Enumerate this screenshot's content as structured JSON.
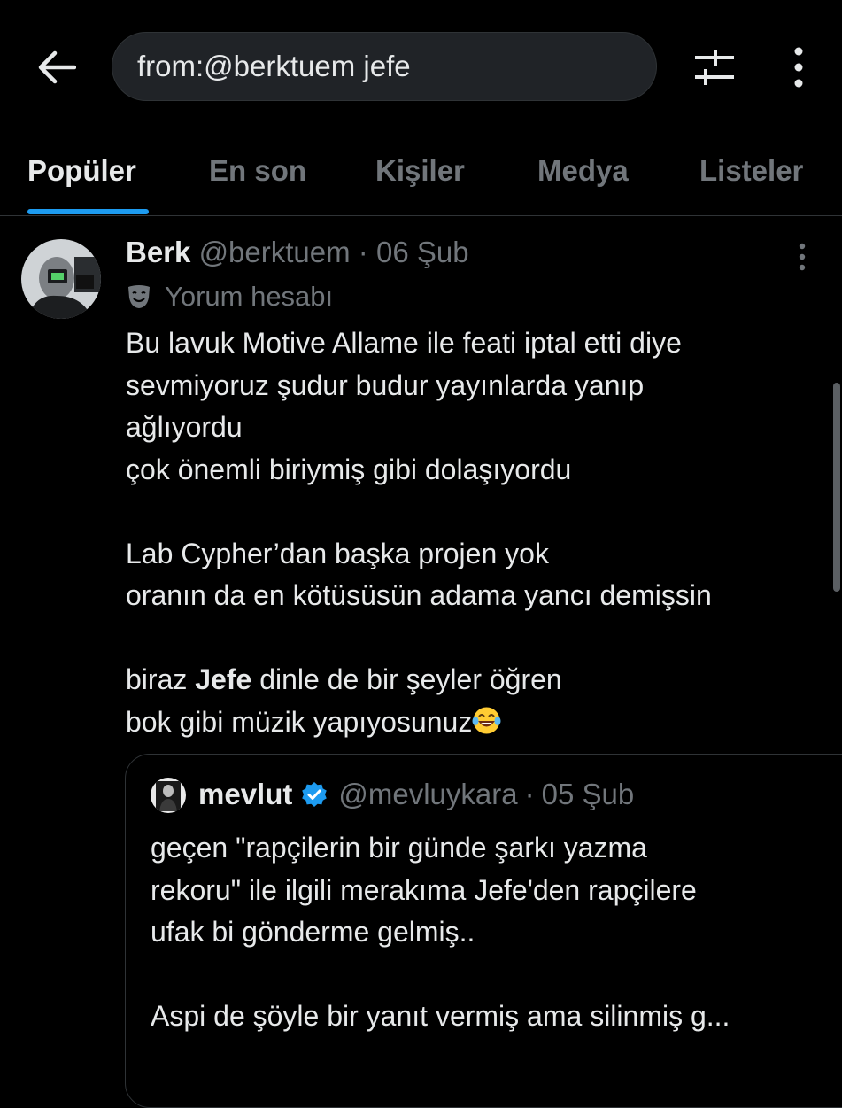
{
  "search": {
    "query": "from:@berktuem jefe"
  },
  "tabs": [
    {
      "label": "Popüler",
      "active": true
    },
    {
      "label": "En son",
      "active": false
    },
    {
      "label": "Kişiler",
      "active": false
    },
    {
      "label": "Medya",
      "active": false
    },
    {
      "label": "Listeler",
      "active": false
    }
  ],
  "tweet": {
    "author_name": "Berk",
    "author_handle": "@berktuem",
    "separator": "·",
    "date": "06 Şub",
    "badge_text": "Yorum hesabı",
    "badge_icon": "drama-mask-icon",
    "lines": [
      "Bu lavuk Motive Allame ile feati iptal etti diye",
      "sevmiyoruz şudur budur yayınlarda yanıp",
      "ağlıyordu",
      "çok önemli biriymiş gibi dolaşıyordu",
      "",
      "Lab Cypher’dan başka projen yok",
      "oranın da en kötüsüsün adama yancı demişsin",
      "",
      {
        "before": "biraz ",
        "highlight": "Jefe",
        "after": " dinle de bir şeyler öğren"
      },
      "bok gibi müzik yapıyosunuz"
    ],
    "trailing_emoji": "tears-of-joy-emoji"
  },
  "quoted_tweet": {
    "author_name": "mevlut",
    "verified": true,
    "author_handle": "@mevluykara",
    "separator": "·",
    "date": "05 Şub",
    "lines": [
      "geçen \"rapçilerin bir günde şarkı yazma",
      "rekoru\" ile ilgili merakıma Jefe'den rapçilere",
      "ufak bi gönderme gelmiş..",
      "",
      "Aspi de şöyle bir yanıt vermiş ama silinmiş g..."
    ]
  },
  "colors": {
    "background": "#000000",
    "text": "#e7e9ea",
    "muted": "#71767b",
    "accent": "#1d9bf0",
    "border": "#2f3336"
  }
}
